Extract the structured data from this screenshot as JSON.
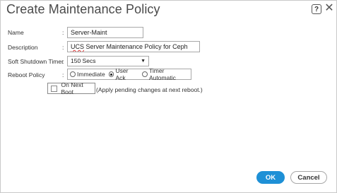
{
  "dialog": {
    "title": "Create Maintenance Policy",
    "help_icon": "question-mark-icon",
    "help_glyph": "?",
    "close_icon": "close-icon",
    "close_glyph": "✕"
  },
  "form": {
    "colon": ":",
    "name": {
      "label": "Name",
      "value": "Server-Maint"
    },
    "description": {
      "label": "Description",
      "value_prefix": "UCS",
      "value_rest": " Server Maintenance Policy for Ceph"
    },
    "soft_shutdown_timer": {
      "label": "Soft Shutdown Timer",
      "value": "150 Secs",
      "arrow": "▼"
    },
    "reboot_policy": {
      "label": "Reboot Policy",
      "options": [
        "Immediate",
        "User Ack",
        "Timer Automatic"
      ],
      "selected": "User Ack"
    },
    "on_next_boot": {
      "label": "On Next Boot",
      "checked": false,
      "hint": "(Apply pending changes at next reboot.)"
    }
  },
  "buttons": {
    "ok": "OK",
    "cancel": "Cancel"
  },
  "colors": {
    "accent": "#1e90d6"
  }
}
